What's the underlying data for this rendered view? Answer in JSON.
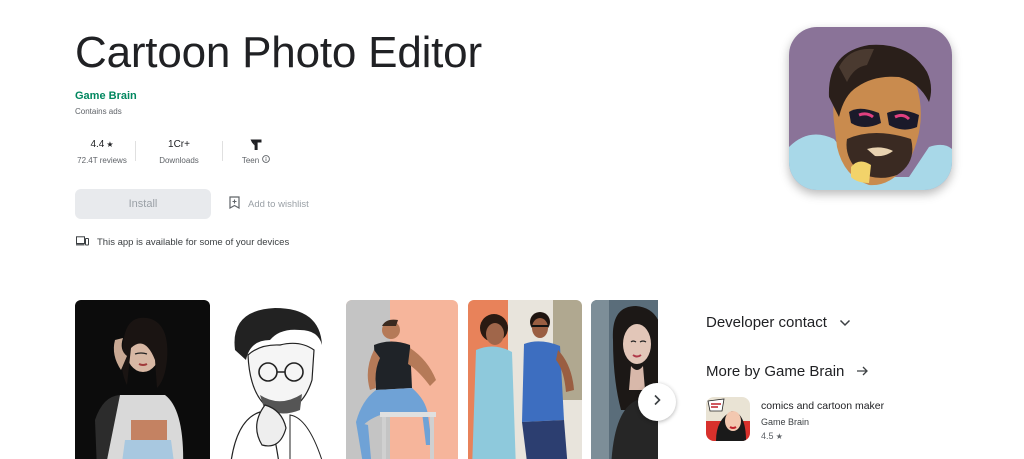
{
  "app": {
    "title": "Cartoon Photo Editor",
    "developer": "Game Brain",
    "ads_notice": "Contains ads"
  },
  "stats": {
    "rating": "4.4",
    "rating_sub": "72.4T reviews",
    "downloads": "1Cr+",
    "downloads_sub": "Downloads",
    "content_rating": "Teen"
  },
  "actions": {
    "install_label": "Install",
    "wishlist_label": "Add to wishlist"
  },
  "availability": "This app is available for some of your devices",
  "sidebar": {
    "developer_contact": "Developer contact",
    "more_by": "More by Game Brain",
    "more_apps": [
      {
        "title": "comics and cartoon maker",
        "developer": "Game Brain",
        "rating": "4.5"
      }
    ]
  },
  "icons": [
    "star-icon",
    "teen-rating-icon",
    "info-icon",
    "bookmark-add-icon",
    "devices-icon",
    "chevron-right-icon",
    "expand-more-icon",
    "arrow-right-icon"
  ],
  "colors": {
    "developer": "#01875f",
    "install_bg": "#e8eaed",
    "app_icon_bg": "#8a7398"
  }
}
